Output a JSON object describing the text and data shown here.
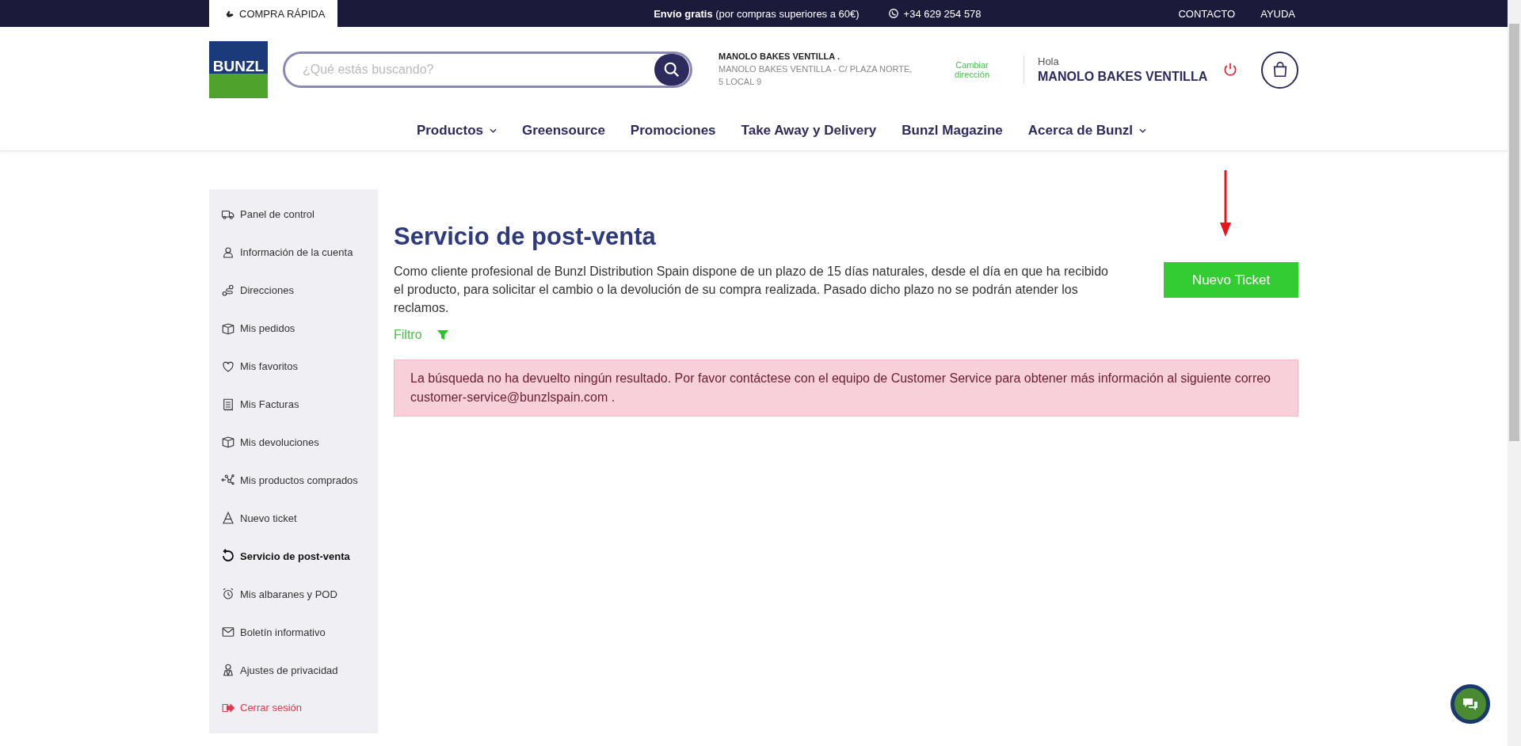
{
  "top_bar": {
    "quick_buy": "COMPRA RÁPIDA",
    "shipping": "**Envío gratis** (por compras superiores a 60€)",
    "phone": "+34 629 254 578",
    "links": [
      "CONTACTO",
      "AYUDA"
    ]
  },
  "header": {
    "logo": "BUNZL",
    "search": {
      "placeholder": "¿Qué estás buscando?"
    },
    "address": {
      "name": "MANOLO BAKES VENTILLA .",
      "line": "MANOLO BAKES VENTILLA - C/ PLAZA NORTE, 5 LOCAL 9"
    },
    "change_address": "Cambiar dirección",
    "greeting": "Hola",
    "user": "MANOLO BAKES VENTILLA"
  },
  "nav": [
    {
      "label": "Productos",
      "dropdown": true
    },
    {
      "label": "Greensource",
      "dropdown": false
    },
    {
      "label": "Promociones",
      "dropdown": false
    },
    {
      "label": "Take Away y Delivery",
      "dropdown": false
    },
    {
      "label": "Bunzl Magazine",
      "dropdown": false
    },
    {
      "label": "Acerca de Bunzl",
      "dropdown": true
    }
  ],
  "sidebar": {
    "items": [
      {
        "label": "Panel de control",
        "selected": false,
        "kind": "link"
      },
      {
        "label": "Información de la cuenta",
        "selected": false,
        "kind": "link"
      },
      {
        "label": "Direcciones",
        "selected": false,
        "kind": "link"
      },
      {
        "label": "Mis pedidos",
        "selected": false,
        "kind": "link"
      },
      {
        "label": "Mis favoritos",
        "selected": false,
        "kind": "link"
      },
      {
        "label": "Mis Facturas",
        "selected": false,
        "kind": "link"
      },
      {
        "label": "Mis devoluciones",
        "selected": false,
        "kind": "link"
      },
      {
        "label": "Mis productos comprados",
        "selected": false,
        "kind": "link"
      },
      {
        "label": "Nuevo ticket",
        "selected": false,
        "kind": "link"
      },
      {
        "label": "Servicio de post-venta",
        "selected": true,
        "kind": "link"
      },
      {
        "label": "Mis albaranes y POD",
        "selected": false,
        "kind": "link"
      },
      {
        "label": "Boletín informativo",
        "selected": false,
        "kind": "link"
      },
      {
        "label": "Ajustes de privacidad",
        "selected": false,
        "kind": "link"
      },
      {
        "label": "Cerrar sesión",
        "selected": false,
        "kind": "logout"
      }
    ]
  },
  "main": {
    "title": "Servicio de post-venta",
    "description": "Como cliente profesional de Bunzl Distribution Spain dispone de un plazo de 15 días naturales, desde el día en que ha recibido el producto, para solicitar el cambio o la devolución de su compra realizada. Pasado dicho plazo no se podrán atender los reclamos.",
    "new_ticket_button": "Nuevo Ticket",
    "filter": "Filtro",
    "alert": "La búsqueda no ha devuelto ningún resultado. Por favor contáctese con el equipo de Customer Service para obtener más información al siguiente correo customer-service@bunzlspain.com ."
  }
}
